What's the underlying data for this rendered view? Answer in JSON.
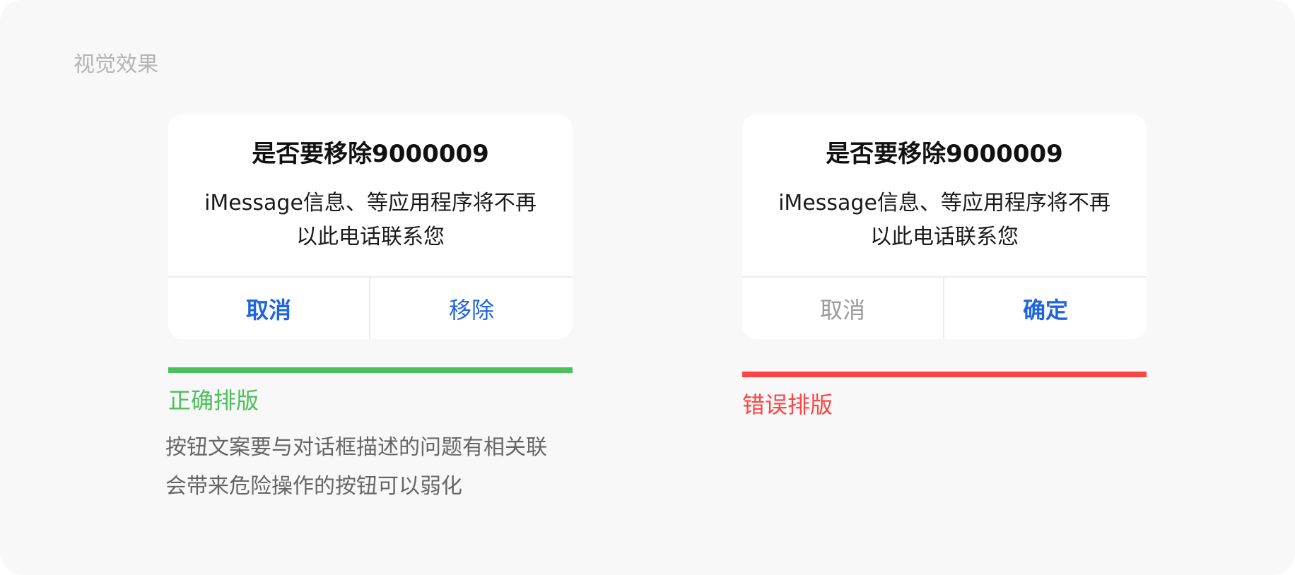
{
  "section_label": "视觉效果",
  "colors": {
    "accent_blue": "#1f64e0",
    "muted_gray": "#9a9a9a",
    "correct_green": "#4cbf5b",
    "wrong_red": "#ff4444"
  },
  "examples": [
    {
      "dialog": {
        "title": "是否要移除9000009",
        "message_line1": "iMessage信息、等应用程序将不再",
        "message_line2": "以此电话联系您",
        "buttons": [
          {
            "label": "取消",
            "emphasis": "bold-blue"
          },
          {
            "label": "移除",
            "emphasis": "regular-blue"
          }
        ]
      },
      "verdict": "正确排版",
      "verdict_color": "#4cbf5b",
      "description_line1": "按钮文案要与对话框描述的问题有相关联",
      "description_line2": "会带来危险操作的按钮可以弱化"
    },
    {
      "dialog": {
        "title": "是否要移除9000009",
        "message_line1": "iMessage信息、等应用程序将不再",
        "message_line2": "以此电话联系您",
        "buttons": [
          {
            "label": "取消",
            "emphasis": "regular-gray"
          },
          {
            "label": "确定",
            "emphasis": "bold-blue"
          }
        ]
      },
      "verdict": "错误排版",
      "verdict_color": "#ff4444"
    }
  ]
}
